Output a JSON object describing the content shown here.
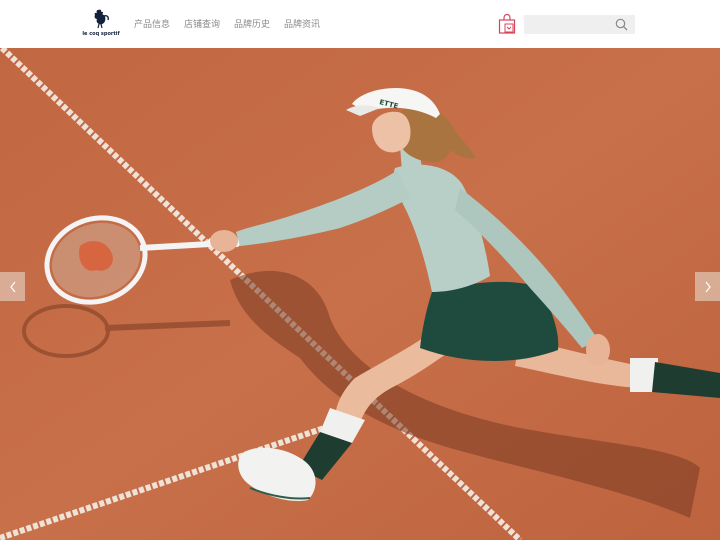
{
  "header": {
    "logo_text": "le coq sportif",
    "nav": [
      {
        "label": "产品信息"
      },
      {
        "label": "店铺查询"
      },
      {
        "label": "品牌历史"
      },
      {
        "label": "品牌资讯"
      }
    ],
    "search": {
      "placeholder": "",
      "value": ""
    },
    "icons": {
      "bag": "shopping-bag-icon",
      "search": "search-icon"
    }
  },
  "hero": {
    "visor_text": "ETTE",
    "carousel_prev_icon": "chevron-left-icon",
    "carousel_next_icon": "chevron-right-icon"
  },
  "colors": {
    "clay": "#c46a43",
    "line": "#f3ece4",
    "top": "#b8cfc8",
    "skirt": "#1f4b3e",
    "bag_accent": "#d9435a"
  }
}
